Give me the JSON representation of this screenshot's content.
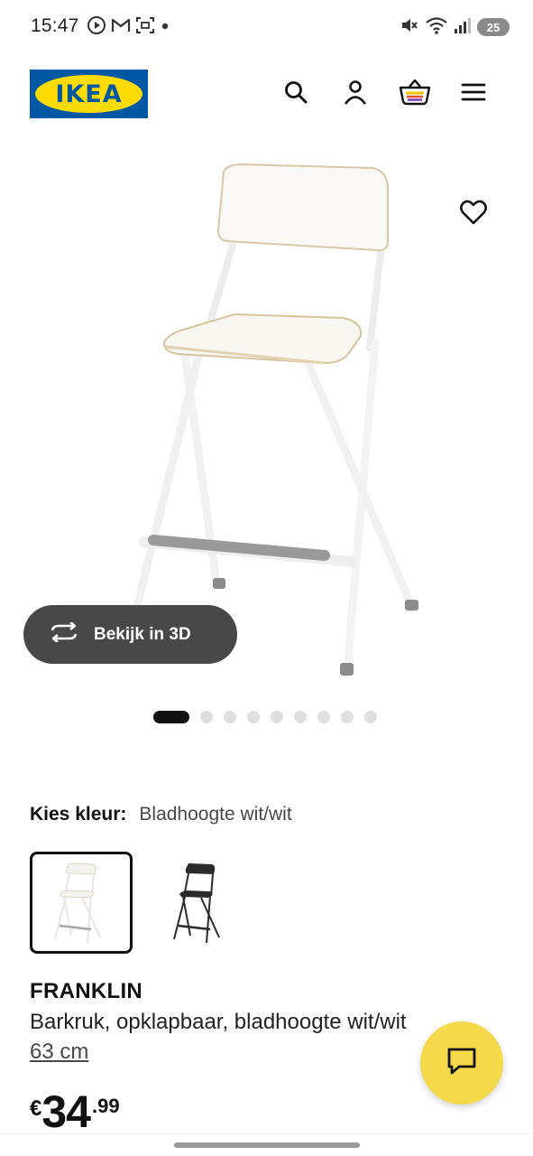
{
  "status_bar": {
    "time": "15:47",
    "icons_left": [
      "play-circle-icon",
      "gmail-icon",
      "screenshot-icon",
      "dot-icon"
    ],
    "icons_right": [
      "mute-icon",
      "wifi-icon",
      "signal-icon"
    ],
    "battery": "25"
  },
  "header": {
    "logo_text": "IKEA",
    "icons": [
      "search-icon",
      "account-icon",
      "shopping-basket-icon",
      "menu-icon"
    ],
    "brand_blue": "#0058A3",
    "brand_yellow": "#FFDB00"
  },
  "gallery": {
    "view3d_label": "Bekijk in 3D",
    "total_images": 10,
    "active_index": 0
  },
  "color_select": {
    "label": "Kies kleur:",
    "value": "Bladhoogte wit/wit",
    "variants": [
      "white",
      "black"
    ],
    "selected_index": 0
  },
  "product": {
    "name": "FRANKLIN",
    "description": "Barkruk, opklapbaar, bladhoogte wit/wit",
    "size": "63 cm",
    "price_currency": "€",
    "price_integer": "34",
    "price_decimal": ".99"
  },
  "chat": {
    "icon": "chat-icon",
    "color": "#F5D94A"
  }
}
